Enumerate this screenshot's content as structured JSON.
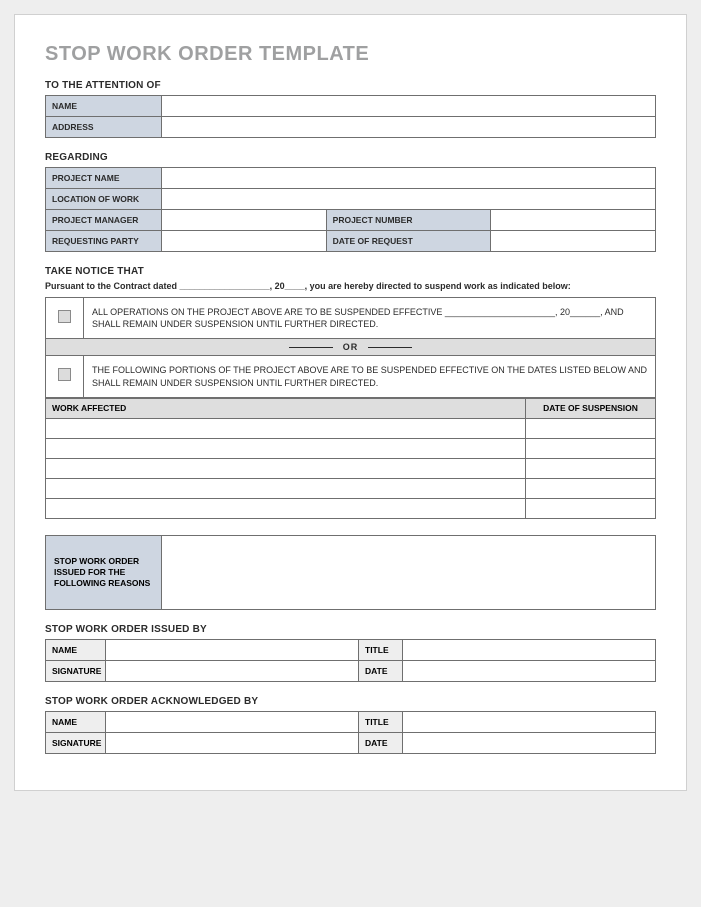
{
  "title": "STOP WORK ORDER TEMPLATE",
  "attention": {
    "heading": "TO THE ATTENTION OF",
    "name_label": "NAME",
    "name_value": "",
    "address_label": "ADDRESS",
    "address_value": ""
  },
  "regarding": {
    "heading": "REGARDING",
    "project_name_label": "PROJECT NAME",
    "project_name_value": "",
    "location_label": "LOCATION OF WORK",
    "location_value": "",
    "pm_label": "PROJECT MANAGER",
    "pm_value": "",
    "pnum_label": "PROJECT NUMBER",
    "pnum_value": "",
    "req_party_label": "REQUESTING PARTY",
    "req_party_value": "",
    "req_date_label": "DATE OF REQUEST",
    "req_date_value": ""
  },
  "notice": {
    "heading": "TAKE NOTICE THAT",
    "intro": "Pursuant to the Contract dated __________________, 20____, you are hereby directed to suspend work as indicated below:",
    "opt1": "ALL OPERATIONS ON THE PROJECT ABOVE ARE TO BE SUSPENDED EFFECTIVE ______________________, 20______, AND SHALL REMAIN UNDER SUSPENSION UNTIL FURTHER DIRECTED.",
    "or": "OR",
    "opt2": "THE FOLLOWING PORTIONS OF THE PROJECT ABOVE ARE TO BE SUSPENDED EFFECTIVE ON THE DATES LISTED BELOW AND SHALL REMAIN UNDER SUSPENSION UNTIL FURTHER DIRECTED.",
    "work_affected_header": "WORK AFFECTED",
    "date_suspension_header": "DATE OF SUSPENSION"
  },
  "reasons": {
    "label": "STOP WORK ORDER ISSUED FOR THE FOLLOWING REASONS",
    "value": ""
  },
  "issued": {
    "heading": "STOP WORK ORDER ISSUED BY",
    "name_label": "NAME",
    "name_value": "",
    "title_label": "TITLE",
    "title_value": "",
    "sig_label": "SIGNATURE",
    "sig_value": "",
    "date_label": "DATE",
    "date_value": ""
  },
  "ack": {
    "heading": "STOP WORK ORDER ACKNOWLEDGED BY",
    "name_label": "NAME",
    "name_value": "",
    "title_label": "TITLE",
    "title_value": "",
    "sig_label": "SIGNATURE",
    "sig_value": "",
    "date_label": "DATE",
    "date_value": ""
  }
}
